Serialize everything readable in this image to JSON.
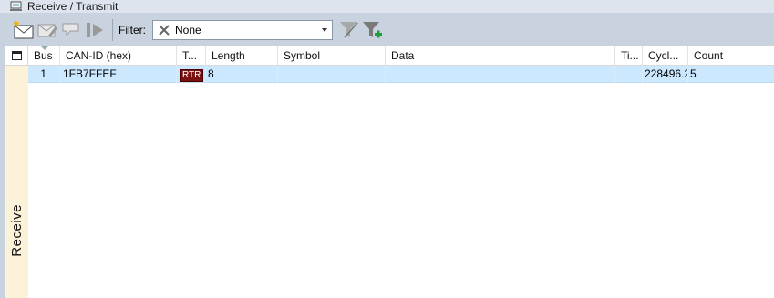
{
  "window": {
    "title": "Receive / Transmit"
  },
  "toolbar": {
    "filter_label": "Filter:",
    "filter_value": "None",
    "buttons": [
      "new-message-icon",
      "edit-message-icon",
      "send-message-icon",
      "transmit-icon",
      "filter-icon",
      "add-filter-icon"
    ]
  },
  "side_panel": {
    "label": "Receive"
  },
  "table": {
    "columns": [
      "Bus",
      "CAN-ID (hex)",
      "T...",
      "Length",
      "Symbol",
      "Data",
      "Ti...",
      "Cycl...",
      "Count"
    ],
    "rows": [
      {
        "bus": "1",
        "can_id": "1FB7FFEF",
        "type": "RTR",
        "length": "8",
        "symbol": "",
        "data": "",
        "time": "",
        "cycle": "228496.2",
        "count": "5"
      }
    ]
  },
  "colors": {
    "toolbar_bg": "#c9d3df",
    "side_panel_bg": "#fbf2d9",
    "selected_row": "#cce8ff",
    "rtr_badge": "#7a1010"
  }
}
